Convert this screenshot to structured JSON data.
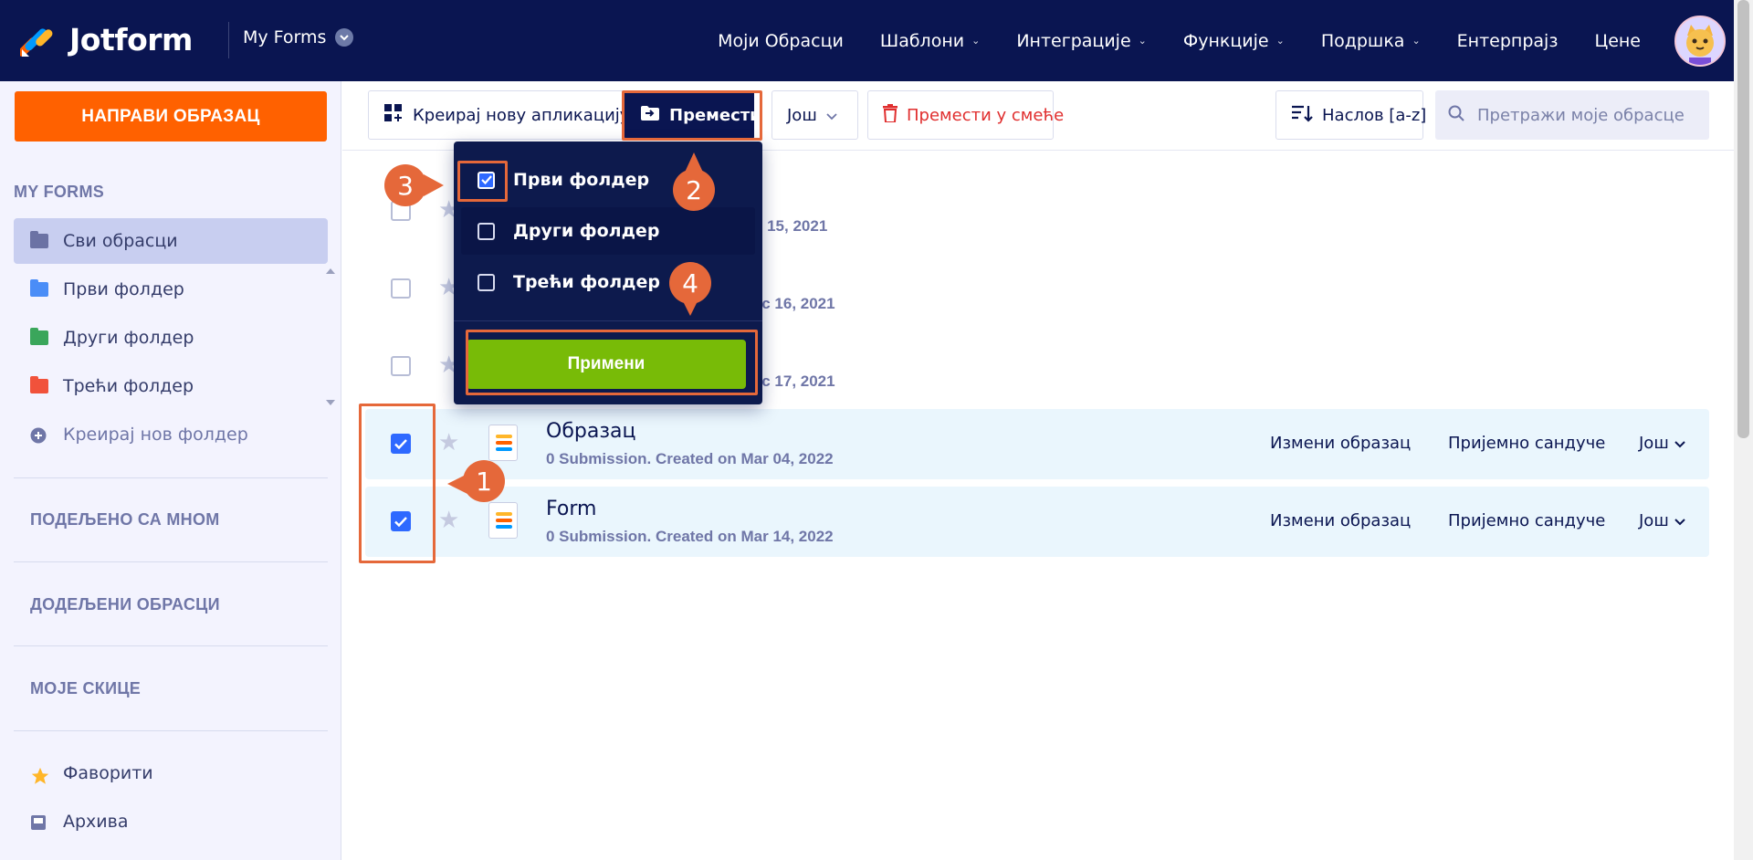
{
  "topnav": {
    "logo": "Jotform",
    "myforms": "My Forms",
    "links": [
      {
        "label": "Моји Обрасци",
        "caret": false
      },
      {
        "label": "Шаблони",
        "caret": true
      },
      {
        "label": "Интеграције",
        "caret": true
      },
      {
        "label": "Функције",
        "caret": true
      },
      {
        "label": "Подршка",
        "caret": true
      },
      {
        "label": "Ентерпрајз",
        "caret": false
      },
      {
        "label": "Цене",
        "caret": false
      }
    ]
  },
  "sidebar": {
    "create_button": "НАПРАВИ ОБРАЗАЦ",
    "heading": "MY FORMS",
    "items": [
      {
        "label": "Сви обрасци",
        "color": "#6b72a4"
      },
      {
        "label": "Први фолдер",
        "color": "#4a8df7"
      },
      {
        "label": "Други фолдер",
        "color": "#3aa65b"
      },
      {
        "label": "Трећи фолдер",
        "color": "#f1523b"
      },
      {
        "label": "Креирај нов фолдер",
        "color": "#6f76a7"
      }
    ],
    "sections": [
      "ПОДЕЉЕНО СА МНОМ",
      "ДОДЕЉЕНИ ОБРАСЦИ",
      "МОЈЕ СКИЦЕ"
    ],
    "bottom": [
      {
        "label": "Фаворити",
        "icon": "star-icon"
      },
      {
        "label": "Архива",
        "icon": "archive-icon"
      }
    ]
  },
  "toolbar": {
    "create_app": "Креирај нову апликацију",
    "move_to": "Премести у",
    "more": "Још",
    "trash": "Премести у смеће",
    "sort": "Наслов [a-z]",
    "search_placeholder": "Претражи моје обрасце"
  },
  "forms": [
    {
      "meta_partial": "о 15, 2021",
      "checked": false
    },
    {
      "meta_partial": "ес 16, 2021",
      "checked": false
    },
    {
      "meta_partial": "ес 17, 2021",
      "checked": false
    },
    {
      "title": "Образац",
      "meta": "0 Submission. Created on Mar 04, 2022",
      "checked": true,
      "edit": "Измени образац",
      "inbox": "Пријемно сандуче",
      "more": "Још"
    },
    {
      "title": "Form",
      "meta": "0 Submission. Created on Mar 14, 2022",
      "checked": true,
      "edit": "Измени образац",
      "inbox": "Пријемно сандуче",
      "more": "Још"
    }
  ],
  "dropdown": {
    "folders": [
      {
        "label": "Први фолдер",
        "checked": true
      },
      {
        "label": "Други фолдер",
        "checked": false
      },
      {
        "label": "Трећи фолдер",
        "checked": false
      }
    ],
    "apply": "Примени"
  },
  "annotations": [
    "1",
    "2",
    "3",
    "4"
  ],
  "colors": {
    "nav_bg": "#0a1551",
    "accent_orange": "#ff6100",
    "apply_green": "#78bb07",
    "annotation": "#e5683a",
    "check_blue": "#2e69ff"
  }
}
